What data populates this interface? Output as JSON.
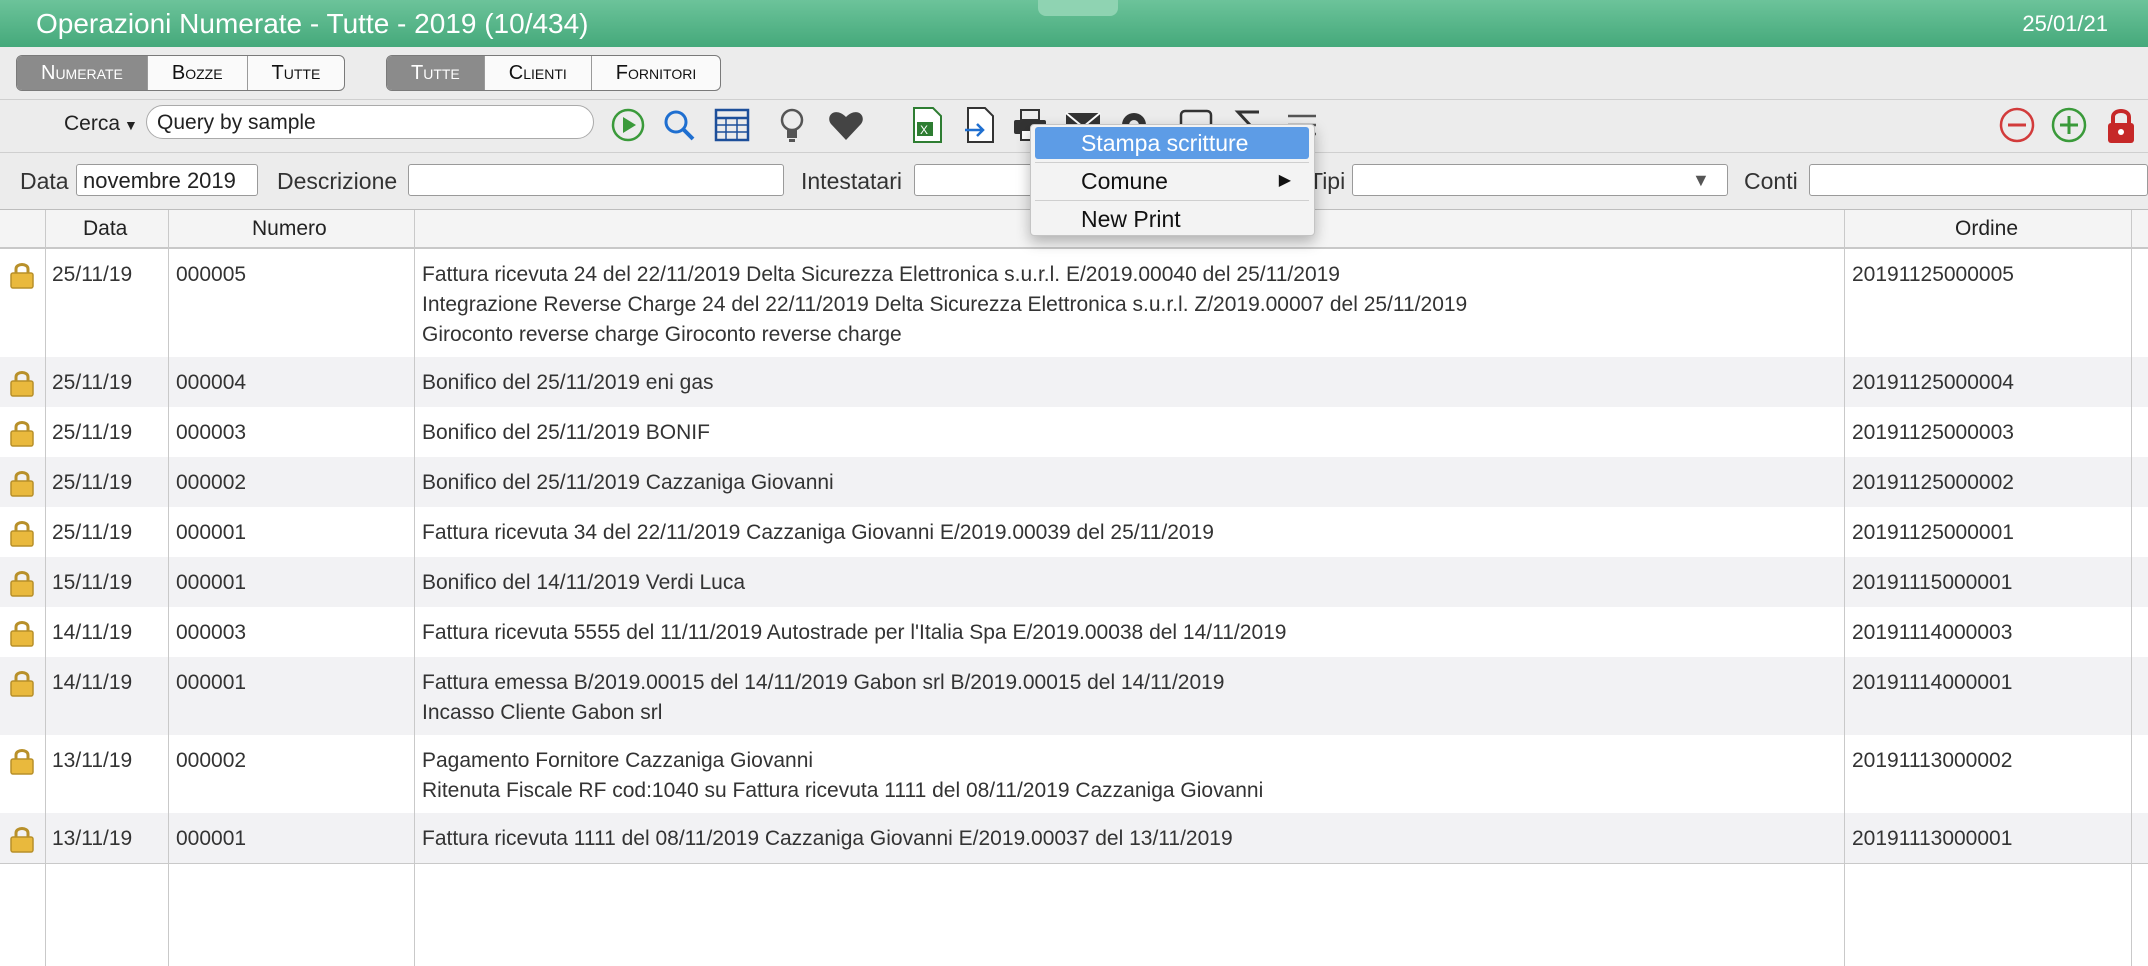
{
  "window": {
    "title": "Operazioni Numerate - Tutte - 2019 (10/434)",
    "date": "25/01/21"
  },
  "status_tabs": [
    {
      "label": "Numerate",
      "active": true
    },
    {
      "label": "Bozze",
      "active": false
    },
    {
      "label": "Tutte",
      "active": false
    }
  ],
  "party_tabs": [
    {
      "label": "Tutte",
      "active": true
    },
    {
      "label": "Clienti",
      "active": false
    },
    {
      "label": "Fornitori",
      "active": false
    }
  ],
  "search": {
    "mode_label": "Cerca",
    "value": "Query by sample"
  },
  "toolbar_icons": [
    "run-icon",
    "search-icon",
    "table-icon",
    "lightbulb-icon",
    "heart-icon",
    "excel-icon",
    "export-icon",
    "print-icon",
    "mail-icon",
    "gear-icon",
    "chart-icon",
    "sigma-icon",
    "menu-icon",
    "remove-icon",
    "add-icon",
    "lock-icon"
  ],
  "filters": {
    "data_label": "Data",
    "data_value": "novembre 2019",
    "descrizione_label": "Descrizione",
    "descrizione_value": "",
    "intestatari_label": "Intestatari",
    "intestatari_value": "",
    "tipi_label": "Tipi",
    "tipi_value": "",
    "conti_label": "Conti",
    "conti_value": ""
  },
  "table": {
    "columns": {
      "data": "Data",
      "numero": "Numero",
      "descrizione": "",
      "ordine": "Ordine"
    },
    "rows": [
      {
        "data": "25/11/19",
        "numero": "000005",
        "desc": [
          "Fattura ricevuta 24 del 22/11/2019 Delta Sicurezza Elettronica s.u.r.l. E/2019.00040 del 25/11/2019",
          "Integrazione Reverse Charge 24 del 22/11/2019 Delta Sicurezza Elettronica s.u.r.l. Z/2019.00007 del 25/11/2019",
          "Giroconto reverse charge Giroconto reverse charge"
        ],
        "ordine": "20191125000005"
      },
      {
        "data": "25/11/19",
        "numero": "000004",
        "desc": [
          "Bonifico del 25/11/2019 eni gas"
        ],
        "ordine": "20191125000004"
      },
      {
        "data": "25/11/19",
        "numero": "000003",
        "desc": [
          "Bonifico del 25/11/2019 BONIF"
        ],
        "ordine": "20191125000003"
      },
      {
        "data": "25/11/19",
        "numero": "000002",
        "desc": [
          "Bonifico del 25/11/2019 Cazzaniga Giovanni"
        ],
        "ordine": "20191125000002"
      },
      {
        "data": "25/11/19",
        "numero": "000001",
        "desc": [
          "Fattura ricevuta 34 del 22/11/2019 Cazzaniga Giovanni E/2019.00039 del 25/11/2019"
        ],
        "ordine": "20191125000001"
      },
      {
        "data": "15/11/19",
        "numero": "000001",
        "desc": [
          "Bonifico del 14/11/2019 Verdi Luca"
        ],
        "ordine": "20191115000001"
      },
      {
        "data": "14/11/19",
        "numero": "000003",
        "desc": [
          "Fattura ricevuta 5555 del 11/11/2019 Autostrade per l'Italia Spa E/2019.00038 del 14/11/2019"
        ],
        "ordine": "20191114000003"
      },
      {
        "data": "14/11/19",
        "numero": "000001",
        "desc": [
          "Fattura emessa B/2019.00015 del 14/11/2019 Gabon srl B/2019.00015 del 14/11/2019",
          "Incasso Cliente Gabon srl"
        ],
        "ordine": "20191114000001"
      },
      {
        "data": "13/11/19",
        "numero": "000002",
        "desc": [
          "Pagamento Fornitore Cazzaniga Giovanni",
          "Ritenuta Fiscale RF cod:1040 su Fattura ricevuta 1111 del 08/11/2019 Cazzaniga Giovanni"
        ],
        "ordine": "20191113000002"
      },
      {
        "data": "13/11/19",
        "numero": "000001",
        "desc": [
          "Fattura ricevuta 1111 del 08/11/2019 Cazzaniga Giovanni E/2019.00037 del 13/11/2019"
        ],
        "ordine": "20191113000001"
      }
    ]
  },
  "context_menu": {
    "items": [
      {
        "label": "Stampa scritture",
        "selected": true,
        "submenu": false
      },
      {
        "label": "Comune",
        "selected": false,
        "submenu": true
      },
      {
        "label": "New Print",
        "selected": false,
        "submenu": false
      }
    ]
  }
}
